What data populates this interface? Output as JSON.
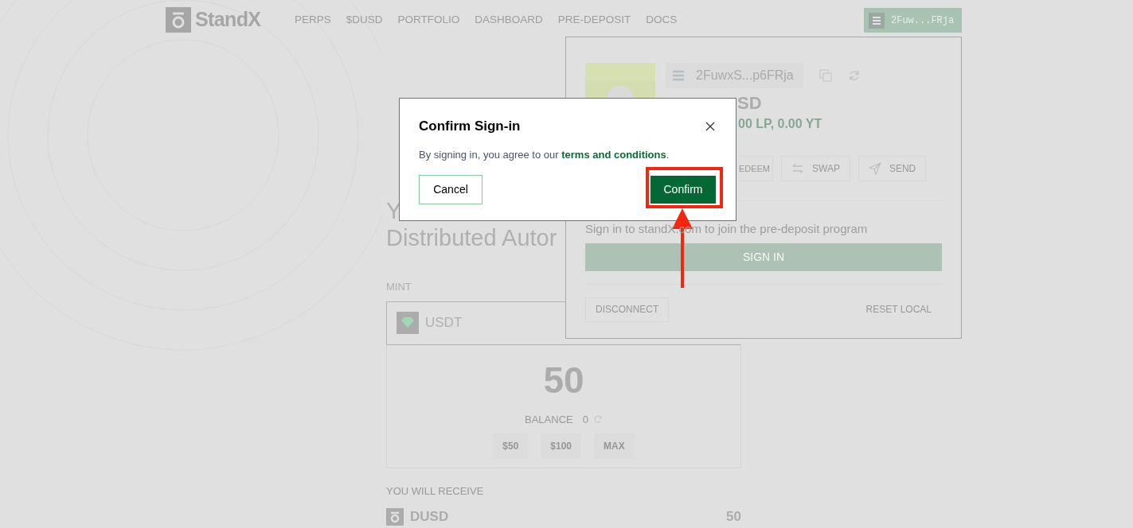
{
  "nav": {
    "logo": "StandX",
    "links": [
      "PERPS",
      "$DUSD",
      "PORTFOLIO",
      "DASHBOARD",
      "PRE-DEPOSIT",
      "DOCS"
    ],
    "wallet_button": "2Fuw...FRja"
  },
  "hero": {
    "subtitle_line_1": "Y",
    "subtitle_line_2": "Distributed Autor"
  },
  "mint": {
    "label": "MINT",
    "token": "USDT",
    "amount": "50",
    "balance_label": "BALANCE",
    "balance": "0",
    "quick_amounts": [
      "$50",
      "$100",
      "MAX"
    ],
    "receive_label": "YOU WILL RECEIVE",
    "receive_token": "DUSD",
    "receive_amount": "50"
  },
  "wallet_panel": {
    "address": "2FuwxS...p6FRja",
    "balance": "SD",
    "holdings": "00 LP, 0.00 YT",
    "actions": [
      {
        "label": "EDEEM",
        "kind": "redeem"
      },
      {
        "label": "SWAP",
        "kind": "swap"
      },
      {
        "label": "SEND",
        "kind": "send"
      }
    ],
    "sign_in_prompt": "Sign in to standX.com to join the pre-deposit program",
    "sign_in_button": "SIGN IN",
    "disconnect_button": "DISCONNECT",
    "reset_button": "RESET LOCAL"
  },
  "modal": {
    "title": "Confirm Sign-in",
    "message_before": "By signing in, you agree to our ",
    "link": "terms and conditions",
    "message_after": ".",
    "cancel_button": "Cancel",
    "confirm_button": "Confirm"
  }
}
